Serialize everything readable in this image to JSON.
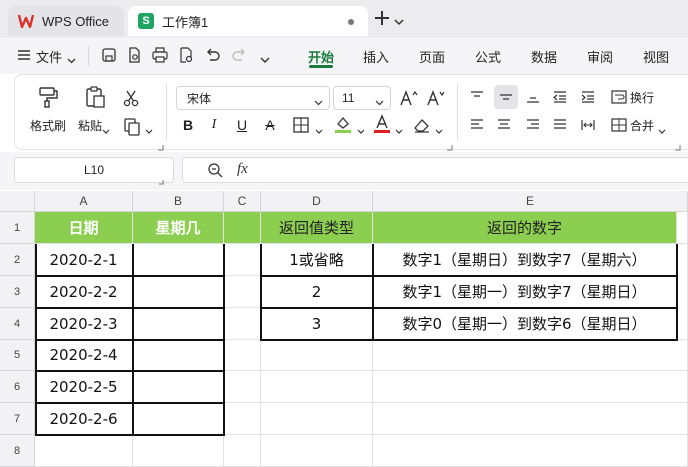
{
  "tabs": [
    {
      "label": "WPS Office"
    },
    {
      "label": "工作簿1"
    }
  ],
  "menu": {
    "file": "文件",
    "tabs": [
      "开始",
      "插入",
      "页面",
      "公式",
      "数据",
      "审阅",
      "视图"
    ]
  },
  "ribbon": {
    "format_painter": "格式刷",
    "paste": "粘贴",
    "font_name": "宋体",
    "font_size": "11",
    "wrap": "换行",
    "merge": "合并"
  },
  "formula_bar": {
    "cell_ref": "L10",
    "fx": "fx",
    "value": ""
  },
  "columns": [
    "A",
    "B",
    "C",
    "D",
    "E"
  ],
  "rows": [
    "1",
    "2",
    "3",
    "4",
    "5",
    "6",
    "7",
    "8"
  ],
  "table1": {
    "headers": [
      "日期",
      "星期几"
    ],
    "dates": [
      "2020-2-1",
      "2020-2-2",
      "2020-2-3",
      "2020-2-4",
      "2020-2-5",
      "2020-2-6"
    ]
  },
  "table2": {
    "headers": [
      "返回值类型",
      "返回的数字"
    ],
    "rows": [
      {
        "type": "1或省略",
        "desc": "数字1（星期日）到数字7（星期六）"
      },
      {
        "type": "2",
        "desc": "数字1（星期一）到数字7（星期日）"
      },
      {
        "type": "3",
        "desc": "数字0（星期一）到数字6（星期日）"
      }
    ]
  },
  "colors": {
    "header_green": "#8ccf50",
    "brand_red": "#d9332b",
    "sheet_green": "#1fa463",
    "accent": "#1a7a3e"
  }
}
